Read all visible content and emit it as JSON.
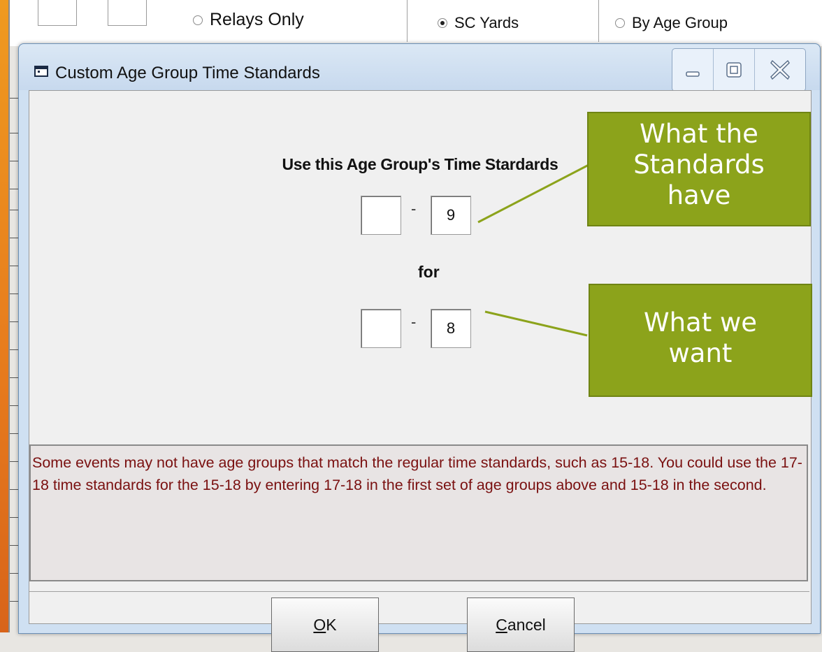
{
  "background_form": {
    "radio_relays_only": "Relays Only",
    "radio_sc_yards": "SC Yards",
    "radio_by_age_group": "By Age Group"
  },
  "dialog": {
    "title": "Custom Age Group Time Standards",
    "heading": "Use this Age Group's Time Stardards",
    "source_age_low": "",
    "source_age_high": "9",
    "dash": "-",
    "for_label": "for",
    "target_age_low": "",
    "target_age_high": "8",
    "hint_text": "Some events may not have age groups that match the regular time standards, such as 15-18. You could use the 17-18 time standards for the 15-18 by entering 17-18 in the first set of age groups above and 15-18 in the second.",
    "ok_prefix": "",
    "ok_underlined": "O",
    "ok_rest": "K",
    "cancel_underlined": "C",
    "cancel_rest": "ancel"
  },
  "callouts": {
    "top": [
      "What the",
      "Standards",
      "have"
    ],
    "bottom": [
      "What we",
      "want"
    ]
  },
  "colors": {
    "callout_fill": "#8ca31b",
    "hint_text": "#7a1010",
    "title_bar": "#cfe0f2",
    "slide_accent": "#e67a1d"
  }
}
